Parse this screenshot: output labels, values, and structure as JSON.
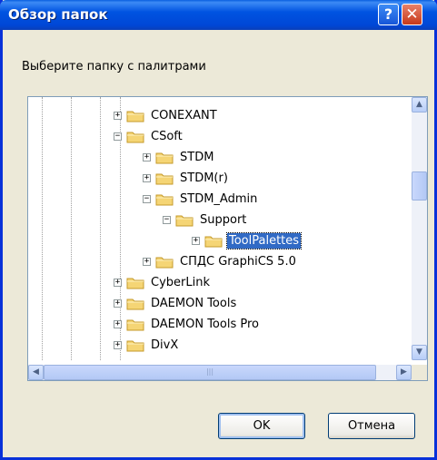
{
  "window": {
    "title": "Обзор папок",
    "help_glyph": "?",
    "close_glyph": "✕"
  },
  "prompt": "Выберите папку с палитрами",
  "tree": {
    "items": [
      {
        "label": "CONEXANT",
        "expander": "+",
        "selected": false
      },
      {
        "label": "CSoft",
        "expander": "−",
        "selected": false
      },
      {
        "label": "STDM",
        "expander": "+",
        "selected": false
      },
      {
        "label": "STDM(r)",
        "expander": "+",
        "selected": false
      },
      {
        "label": "STDM_Admin",
        "expander": "−",
        "selected": false
      },
      {
        "label": "Support",
        "expander": "−",
        "selected": false
      },
      {
        "label": "ToolPalettes",
        "expander": "+",
        "selected": true
      },
      {
        "label": "СПДС GraphiCS 5.0",
        "expander": "+",
        "selected": false
      },
      {
        "label": "CyberLink",
        "expander": "+",
        "selected": false
      },
      {
        "label": "DAEMON Tools",
        "expander": "+",
        "selected": false
      },
      {
        "label": "DAEMON Tools Pro",
        "expander": "+",
        "selected": false
      },
      {
        "label": "DivX",
        "expander": "+",
        "selected": false
      }
    ]
  },
  "scrollbars": {
    "up": "▲",
    "down": "▼",
    "left": "◀",
    "right": "▶",
    "grip": "|||"
  },
  "buttons": {
    "ok": "OK",
    "cancel": "Отмена"
  },
  "colors": {
    "titlebar": "#0053e1",
    "selection": "#316ac5",
    "folder": "#f5d575"
  }
}
